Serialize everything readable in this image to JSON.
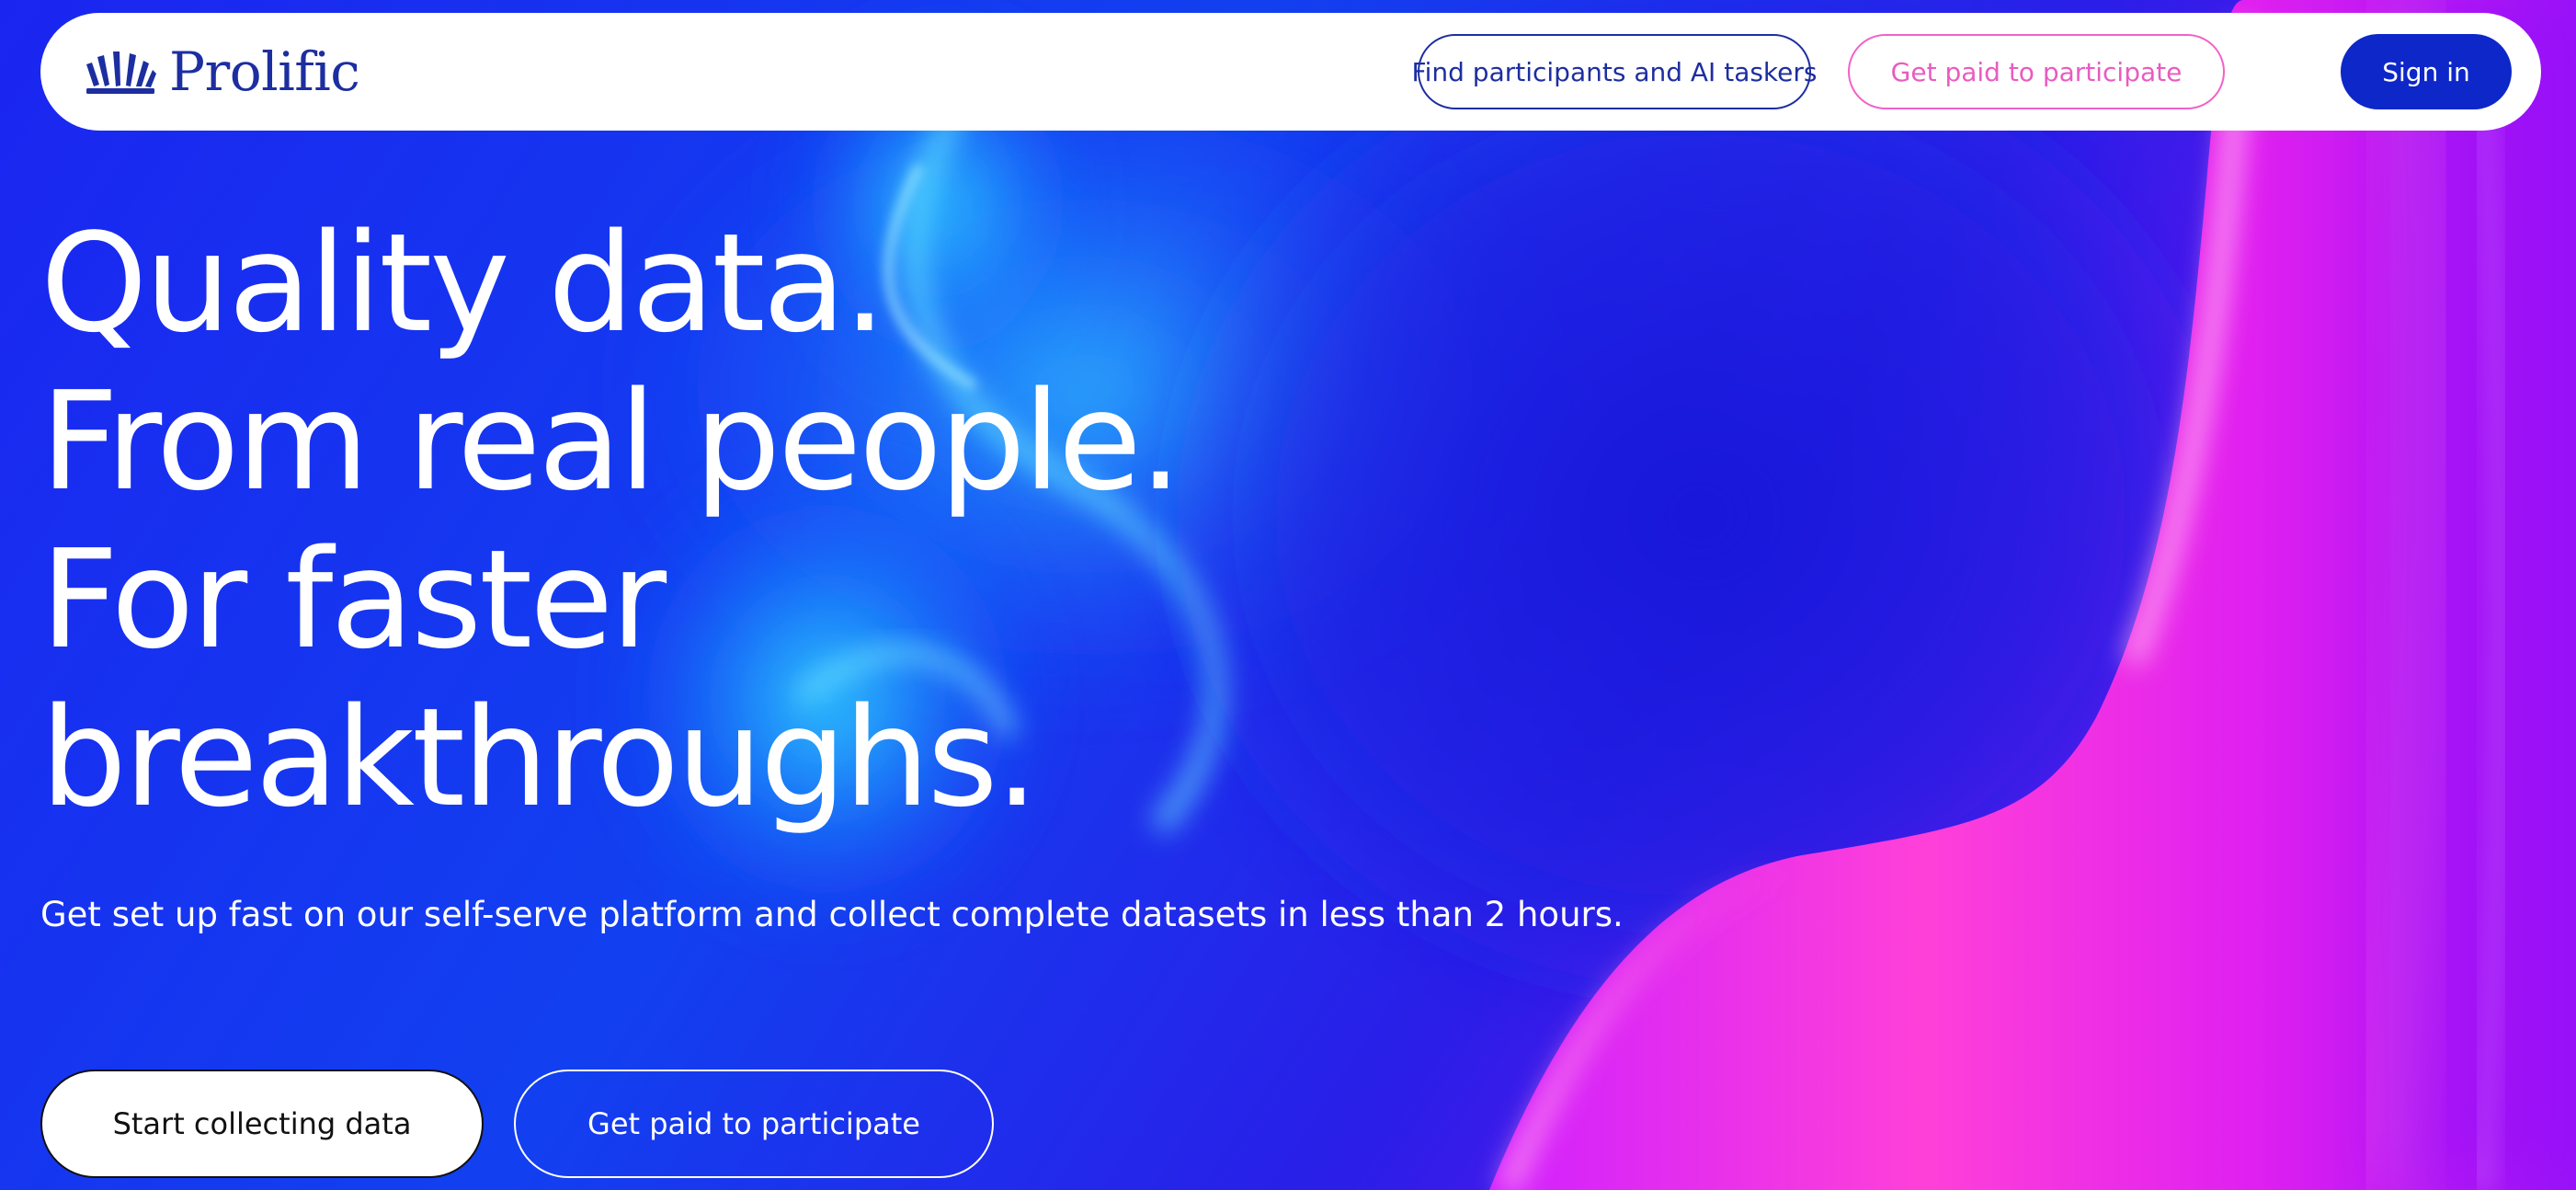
{
  "brand": {
    "name": "Prolific",
    "logo_color": "#1d2ea0"
  },
  "nav": {
    "find_label": "Find participants and AI taskers",
    "paid_label": "Get paid to participate",
    "signin_label": "Sign in"
  },
  "hero": {
    "headline_lines": [
      "Quality data.",
      "From real people.",
      "For faster",
      "breakthroughs."
    ],
    "subtitle": "Get set up fast on our self-serve platform and collect complete datasets in less than 2 hours.",
    "primary_cta": "Start collecting data",
    "secondary_cta": "Get paid to participate"
  },
  "colors": {
    "background_blue": "#1a1fe8",
    "accent_magenta": "#ff3fd6",
    "accent_cyan": "#2fd9ff",
    "button_navy": "#0d27c9"
  }
}
